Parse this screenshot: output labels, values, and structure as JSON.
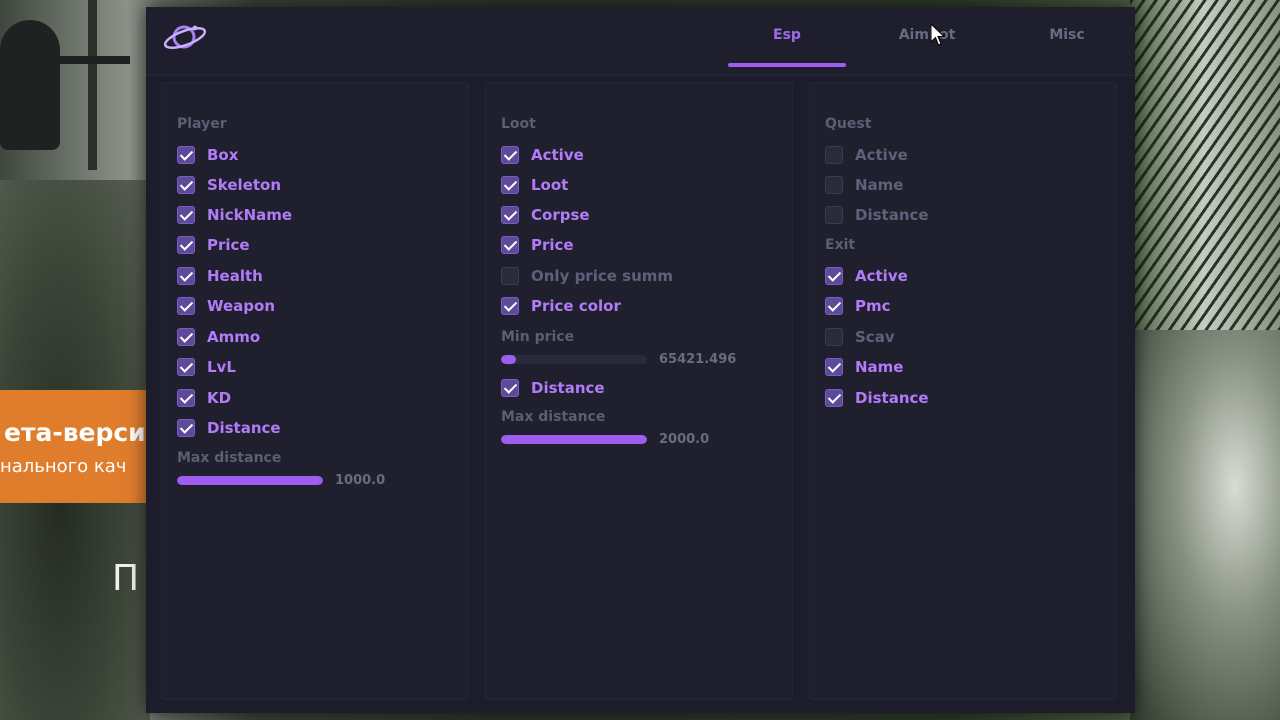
{
  "background": {
    "promo_line1": "ета-верси",
    "promo_line2": "нального кач",
    "big_letter": "П"
  },
  "menu": {
    "logo_icon": "planet-ring-icon",
    "accent_color": "#9f5cf1",
    "tabs": [
      {
        "label": "Esp",
        "active": true
      },
      {
        "label": "Aimbot",
        "active": false
      },
      {
        "label": "Misc",
        "active": false
      }
    ]
  },
  "player": {
    "title": "Player",
    "items": [
      {
        "label": "Box",
        "checked": true
      },
      {
        "label": "Skeleton",
        "checked": true
      },
      {
        "label": "NickName",
        "checked": true
      },
      {
        "label": "Price",
        "checked": true
      },
      {
        "label": "Health",
        "checked": true
      },
      {
        "label": "Weapon",
        "checked": true
      },
      {
        "label": "Ammo",
        "checked": true
      },
      {
        "label": "LvL",
        "checked": true
      },
      {
        "label": "KD",
        "checked": true
      },
      {
        "label": "Distance",
        "checked": true
      }
    ],
    "max_distance": {
      "label": "Max distance",
      "value": "1000.0",
      "fill_fraction": 1.0
    }
  },
  "loot": {
    "title": "Loot",
    "items": [
      {
        "label": "Active",
        "checked": true
      },
      {
        "label": "Loot",
        "checked": true
      },
      {
        "label": "Corpse",
        "checked": true
      },
      {
        "label": "Price",
        "checked": true
      },
      {
        "label": "Only price summ",
        "checked": false
      },
      {
        "label": "Price color",
        "checked": true
      }
    ],
    "min_price": {
      "label": "Min price",
      "value": "65421.496",
      "fill_fraction": 0.1
    },
    "distance": {
      "label": "Distance",
      "checked": true
    },
    "max_distance": {
      "label": "Max distance",
      "value": "2000.0",
      "fill_fraction": 1.0
    }
  },
  "quest": {
    "title": "Quest",
    "items": [
      {
        "label": "Active",
        "checked": false
      },
      {
        "label": "Name",
        "checked": false
      },
      {
        "label": "Distance",
        "checked": false
      }
    ]
  },
  "exit": {
    "title": "Exit",
    "items": [
      {
        "label": "Active",
        "checked": true
      },
      {
        "label": "Pmc",
        "checked": true
      },
      {
        "label": "Scav",
        "checked": false
      },
      {
        "label": "Name",
        "checked": true
      },
      {
        "label": "Distance",
        "checked": true
      }
    ]
  }
}
